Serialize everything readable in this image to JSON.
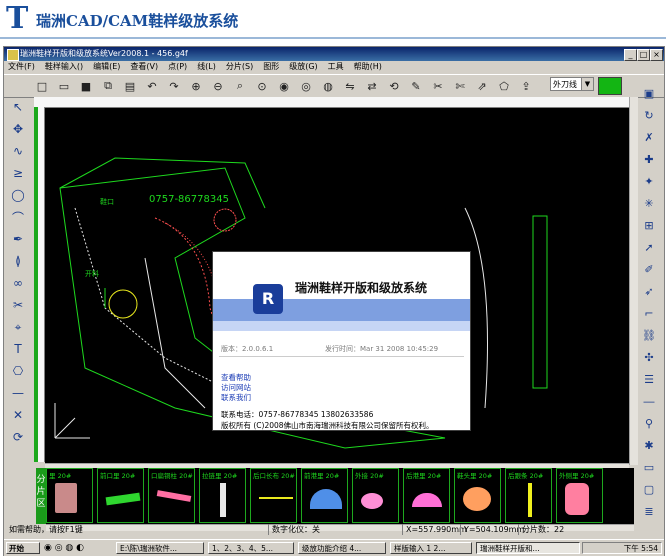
{
  "header": {
    "logo_letter": "T",
    "title": "瑞洲CAD/CAM鞋样级放系统"
  },
  "window": {
    "title": "瑞洲鞋样开版和级放系统Ver2008.1 - 456.g4f"
  },
  "menu": [
    "文件(F)",
    "鞋样输入()",
    "编辑(E)",
    "查看(V)",
    "点(P)",
    "线(L)",
    "分片(S)",
    "图形",
    "级放(G)",
    "工具",
    "帮助(H)"
  ],
  "toolbar": {
    "knife_label": "外刀线",
    "knife_color": "#13b513"
  },
  "canvas_labels": {
    "top_text": "0757-86778345",
    "neck_label": "鞋口",
    "left_label": "开料"
  },
  "splash": {
    "app_name": "瑞洲鞋样开版和级放系统",
    "logo_letter": "R",
    "version": "版本：2.0.0.6.1",
    "release": "发行时间：Mar 31 2008 10:45:29",
    "links": [
      "查看帮助",
      "访问网站",
      "联系我们"
    ],
    "contact": "联系电话：0757-86778345    13802633586",
    "copyright": "版权所有 (C)2008佛山市南海瑞洲科技有限公司保留所有权利。"
  },
  "strip": {
    "label": "分片区",
    "pieces": [
      {
        "label": "里 20#",
        "color": "#c98a8a"
      },
      {
        "label": "前口里 20#",
        "color": "#2fd62f"
      },
      {
        "label": "口扁铜柱 20#",
        "color": "#ff6fa3"
      },
      {
        "label": "拉链里 20#",
        "color": "#e8e8e8"
      },
      {
        "label": "后口长布 20#",
        "color": "#e8e81e"
      },
      {
        "label": "前港里 20#",
        "color": "#4f8fe8"
      },
      {
        "label": "外接 20#",
        "color": "#ff8fd6"
      },
      {
        "label": "后港里 20#",
        "color": "#ff6fd6"
      },
      {
        "label": "鞋头里 20#",
        "color": "#ff9f5f"
      },
      {
        "label": "后跟条 20#",
        "color": "#f0f01e"
      },
      {
        "label": "外侧里 20#",
        "color": "#ff7fa0"
      }
    ]
  },
  "status": {
    "help": "如需帮助，请按F1键",
    "digitizer": "数字化仪：关",
    "x": "X=557.990mm",
    "y": "Y=504.109mm",
    "pieces": "分片数：22"
  },
  "taskbar": {
    "start": "开始",
    "tasks": [
      "E:\\陈\\瑞洲软件...",
      "1、2、3、4、5...",
      "级放功能介绍 4...",
      "样版输入 1 2...",
      "瑞洲鞋样开版和..."
    ],
    "clock": "下午 5:54"
  }
}
